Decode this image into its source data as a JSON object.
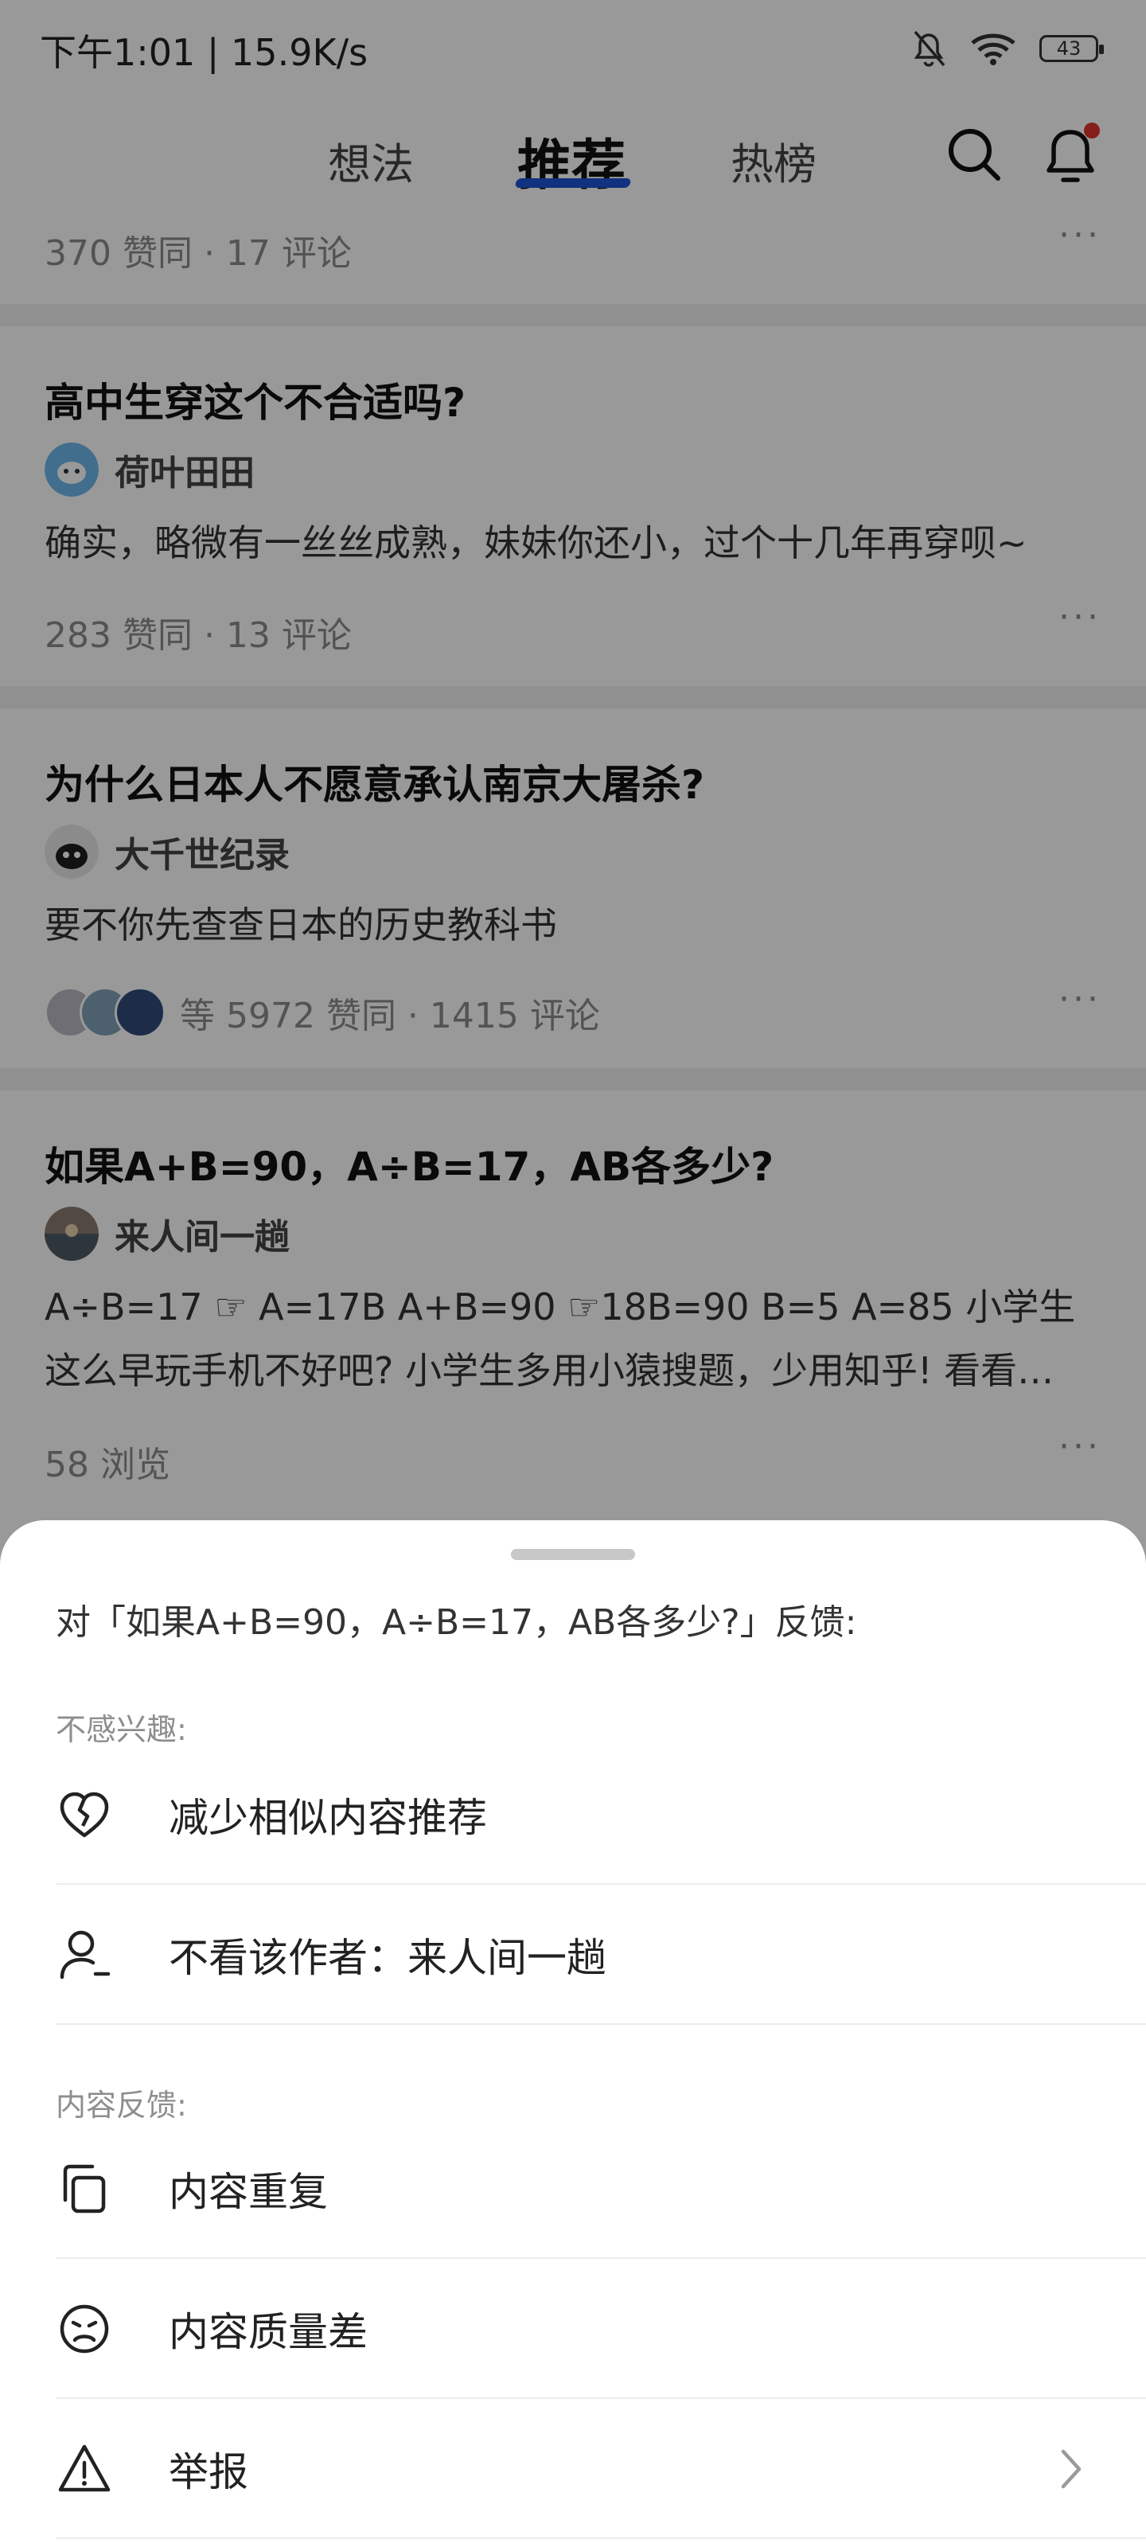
{
  "status_bar": {
    "time_speed": "下午1:01 | 15.9K/s",
    "battery": "43"
  },
  "nav": {
    "tabs": [
      "想法",
      "推荐",
      "热榜"
    ],
    "active_tab": "推荐"
  },
  "feed": {
    "top_meta": "370 赞同 · 17 评论",
    "cards": [
      {
        "title": "高中生穿这个不合适吗?",
        "author": "荷叶田田",
        "text": "确实，略微有一丝丝成熟，妹妹你还小，过个十几年再穿呗~",
        "meta": "283 赞同 · 13 评论"
      },
      {
        "title": "为什么日本人不愿意承认南京大屠杀?",
        "author": "大千世纪录",
        "text": "要不你先查查日本的历史教科书",
        "meta": "等 5972 赞同 · 1415 评论"
      },
      {
        "title": "如果A+B=90，A÷B=17，AB各多少?",
        "author": "来人间一趟",
        "text": "A÷B=17 ☞ A=17B A+B=90 ☞18B=90 B=5 A=85 小学生这么早玩手机不好吧? 小学生多用小猿搜题，少用知乎! 看看…",
        "meta": "58 浏览"
      }
    ],
    "more": "···"
  },
  "sheet": {
    "title": "对「如果A+B=90，A÷B=17，AB各多少?」反馈:",
    "section1_label": "不感兴趣:",
    "reduce_similar": "减少相似内容推荐",
    "block_author": "不看该作者：来人间一趟",
    "section2_label": "内容反馈:",
    "duplicate": "内容重复",
    "low_quality": "内容质量差",
    "report": "举报"
  },
  "colors": {
    "accent": "#1d54d6",
    "notification_dot": "#e0322b"
  }
}
